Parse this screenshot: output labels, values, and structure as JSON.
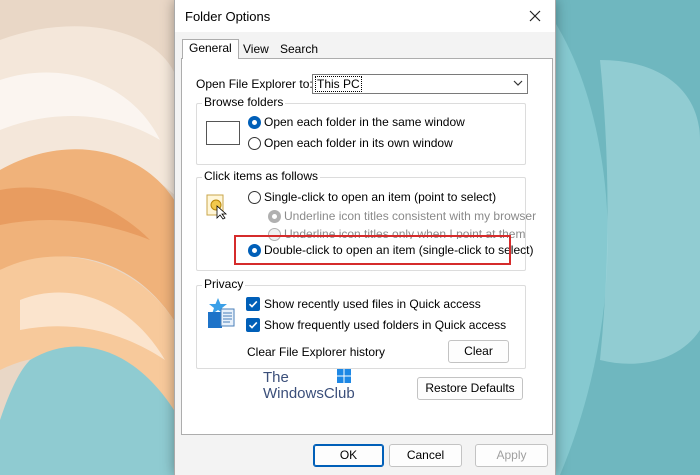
{
  "window": {
    "title": "Folder Options"
  },
  "tabs": [
    {
      "label": "General",
      "active": true
    },
    {
      "label": "View",
      "active": false
    },
    {
      "label": "Search",
      "active": false
    }
  ],
  "open_explorer": {
    "label": "Open File Explorer to:",
    "value": "This PC"
  },
  "browse_folders": {
    "title": "Browse folders",
    "options": [
      {
        "label": "Open each folder in the same window",
        "checked": true
      },
      {
        "label": "Open each folder in its own window",
        "checked": false
      }
    ]
  },
  "click_items": {
    "title": "Click items as follows",
    "single_click": {
      "label": "Single-click to open an item (point to select)",
      "checked": false
    },
    "underline_consistent": {
      "label": "Underline icon titles consistent with my browser",
      "enabled": false
    },
    "underline_point": {
      "label": "Underline icon titles only when I point at them",
      "enabled": false
    },
    "double_click": {
      "label": "Double-click to open an item (single-click to select)",
      "checked": true
    }
  },
  "privacy": {
    "title": "Privacy",
    "recent_files": {
      "label": "Show recently used files in Quick access",
      "checked": true
    },
    "frequent_folders": {
      "label": "Show frequently used folders in Quick access",
      "checked": true
    },
    "clear_history_label": "Clear File Explorer history",
    "clear_button": "Clear"
  },
  "restore_defaults": "Restore Defaults",
  "watermark": {
    "line1": "The",
    "line2": "WindowsClub"
  },
  "buttons": {
    "ok": "OK",
    "cancel": "Cancel",
    "apply": "Apply"
  },
  "colors": {
    "accent": "#005fb8",
    "highlight": "#d52b2b",
    "desktop": "#7fc6cd"
  }
}
